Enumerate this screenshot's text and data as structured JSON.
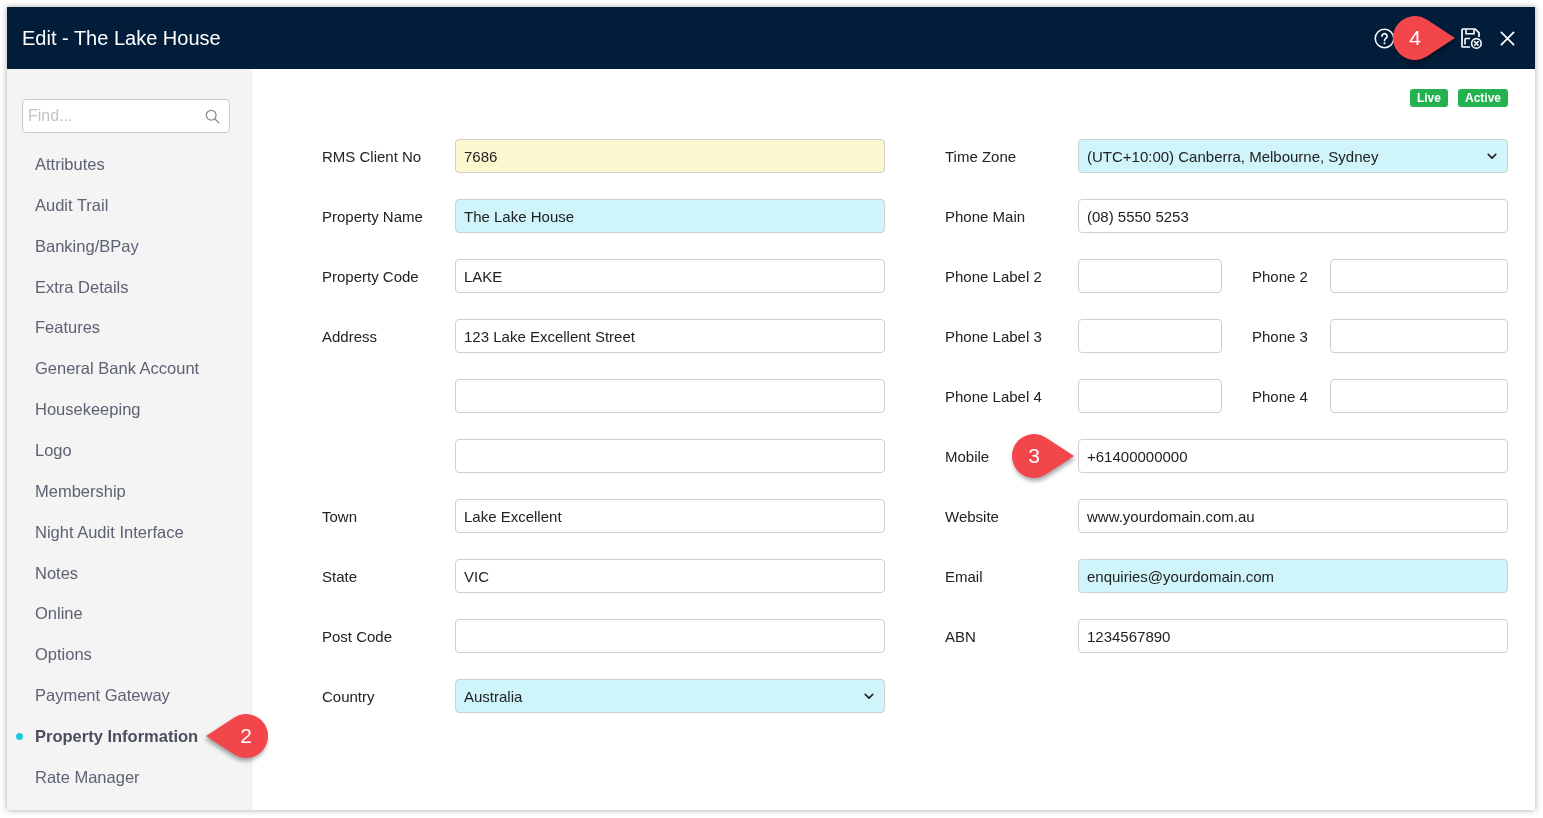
{
  "window": {
    "title": "Edit - The Lake House",
    "actions": [
      {
        "kind": "help"
      },
      {
        "kind": "discard",
        "callout": {
          "number": "4",
          "kind": "right"
        }
      },
      {
        "kind": "close"
      }
    ]
  },
  "sidebar": {
    "search": {
      "placeholder": "Find..."
    },
    "items": [
      {
        "label": "Attributes",
        "selected": false
      },
      {
        "label": "Audit Trail",
        "selected": false
      },
      {
        "label": "Banking/BPay",
        "selected": false
      },
      {
        "label": "Extra Details",
        "selected": false
      },
      {
        "label": "Features",
        "selected": false
      },
      {
        "label": "General Bank Account",
        "selected": false
      },
      {
        "label": "Housekeeping",
        "selected": false
      },
      {
        "label": "Logo",
        "selected": false
      },
      {
        "label": "Membership",
        "selected": false
      },
      {
        "label": "Night Audit Interface",
        "selected": false
      },
      {
        "label": "Notes",
        "selected": false
      },
      {
        "label": "Online",
        "selected": false
      },
      {
        "label": "Options",
        "selected": false
      },
      {
        "label": "Payment Gateway",
        "selected": false
      },
      {
        "label": "Property Information",
        "selected": true,
        "callout": {
          "number": "2",
          "kind": "left"
        }
      },
      {
        "label": "Rate Manager",
        "selected": false
      }
    ]
  },
  "status_badges": [
    {
      "label": "Live"
    },
    {
      "label": "Active"
    }
  ],
  "form": {
    "left": [
      {
        "kind": "text",
        "label": "RMS Client No",
        "value": "7686",
        "color": "#fdf7cf"
      },
      {
        "kind": "text",
        "label": "Property Name",
        "value": "The Lake House",
        "color": "#cff4f9"
      },
      {
        "kind": "text",
        "label": "Property Code",
        "value": "LAKE"
      },
      {
        "kind": "text",
        "label": "Address",
        "value": "123 Lake Excellent Street"
      },
      {
        "kind": "text"
      },
      {
        "kind": "text"
      },
      {
        "kind": "text",
        "label": "Town",
        "value": "Lake Excellent"
      },
      {
        "kind": "text",
        "label": "State",
        "value": "VIC"
      },
      {
        "kind": "text",
        "label": "Post Code"
      },
      {
        "kind": "select",
        "label": "Country",
        "value": "Australia",
        "color": "#cff4f9"
      }
    ],
    "right": [
      {
        "kind": "select",
        "label": "Time Zone",
        "value": "(UTC+10:00) Canberra, Melbourne, Sydney",
        "color": "#cff4f9"
      },
      {
        "kind": "text",
        "label": "Phone Main",
        "value": "(08) 5550 5253"
      },
      {
        "kind": "split",
        "parts": [
          {
            "label": "Phone Label 2"
          },
          {
            "label": "Phone 2"
          }
        ]
      },
      {
        "kind": "split",
        "parts": [
          {
            "label": "Phone Label 3"
          },
          {
            "label": "Phone 3"
          }
        ]
      },
      {
        "kind": "split",
        "parts": [
          {
            "label": "Phone Label 4"
          },
          {
            "label": "Phone 4"
          }
        ]
      },
      {
        "kind": "text",
        "label": "Mobile",
        "value": "+61400000000",
        "callout": {
          "number": "3",
          "kind": "right"
        }
      },
      {
        "kind": "text",
        "label": "Website",
        "value": "www.yourdomain.com.au"
      },
      {
        "kind": "text",
        "label": "Email",
        "value": "enquiries@yourdomain.com",
        "color": "#cff4f9"
      },
      {
        "kind": "text",
        "label": "ABN",
        "value": "1234567890"
      }
    ]
  }
}
